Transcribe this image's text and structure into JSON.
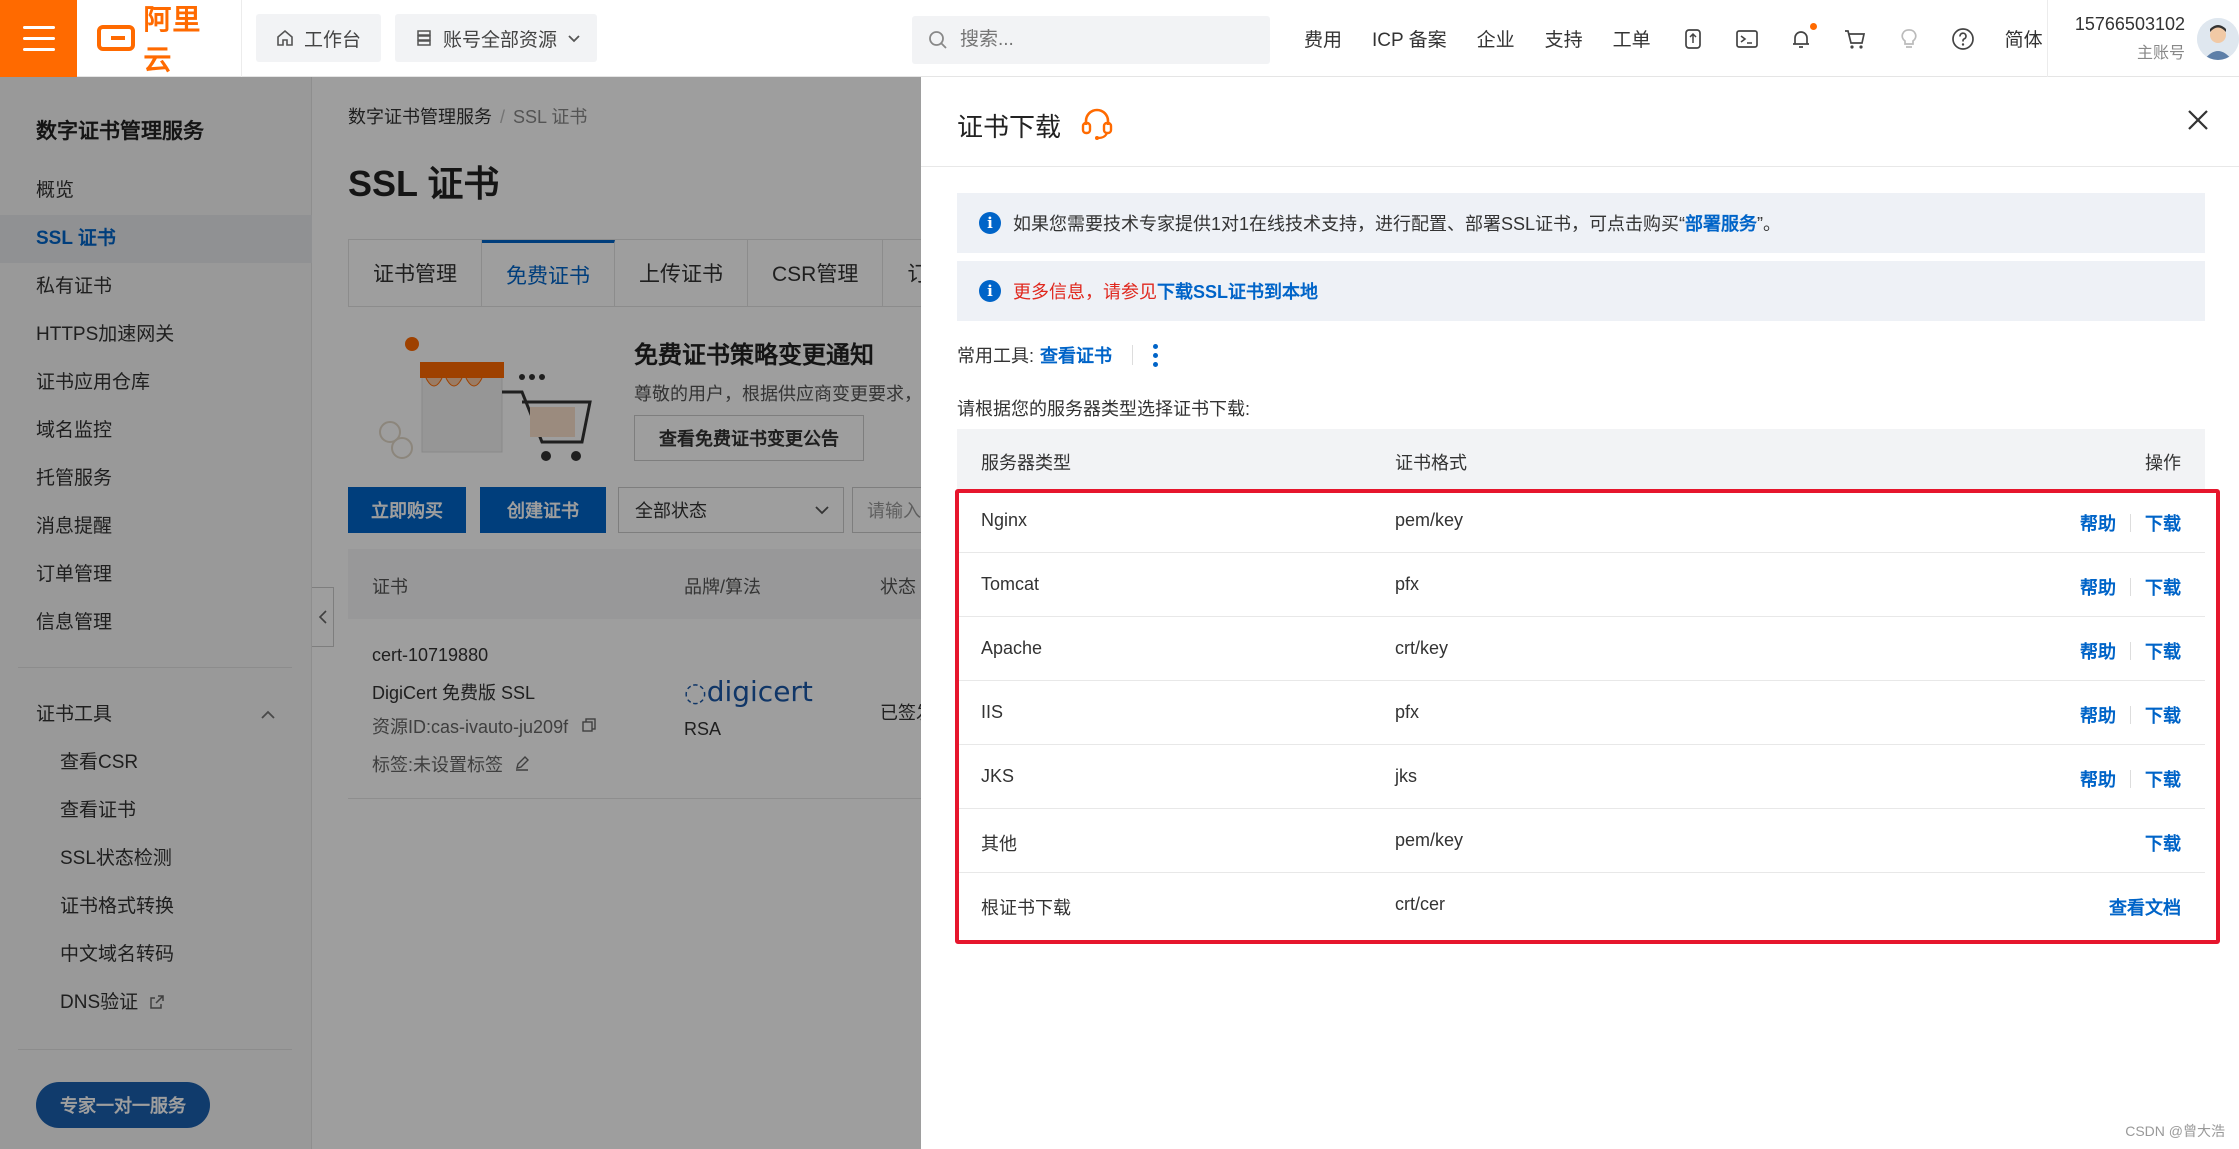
{
  "topbar": {
    "logo_text": "阿里云",
    "workbench": "工作台",
    "resources": "账号全部资源",
    "search_placeholder": "搜索...",
    "links": [
      "费用",
      "ICP 备案",
      "企业",
      "支持",
      "工单"
    ],
    "lang": "简体",
    "account_phone": "15766503102",
    "account_role": "主账号",
    "accent": "#ff6a00"
  },
  "sidebar": {
    "title": "数字证书管理服务",
    "items": [
      "概览",
      "SSL 证书",
      "私有证书",
      "HTTPS加速网关",
      "证书应用仓库",
      "域名监控",
      "托管服务",
      "消息提醒",
      "订单管理",
      "信息管理"
    ],
    "active": "SSL 证书",
    "tools_title": "证书工具",
    "tools": [
      "查看CSR",
      "查看证书",
      "SSL状态检测",
      "证书格式转换",
      "中文域名转码",
      "DNS验证"
    ],
    "expert_button": "专家一对一服务"
  },
  "main": {
    "breadcrumb": [
      "数字证书管理服务",
      "SSL 证书"
    ],
    "title": "SSL 证书",
    "tabs": [
      "证书管理",
      "免费证书",
      "上传证书",
      "CSR管理",
      "订"
    ],
    "active_tab": "免费证书",
    "notice_title": "免费证书策略变更通知",
    "notice_desc": "尊敬的用户，根据供应商变更要求，",
    "notice_button": "查看免费证书变更公告",
    "buy_button": "立即购买",
    "create_button": "创建证书",
    "status_select": "全部状态",
    "filter_placeholder": "请输入",
    "columns": [
      "证书",
      "品牌/算法",
      "状态"
    ],
    "row": {
      "cert_id": "cert-10719880",
      "cert_name": "DigiCert 免费版 SSL",
      "resource_id": "资源ID:cas-ivauto-ju209f",
      "tag": "标签:未设置标签",
      "brand": "digicert",
      "algorithm": "RSA",
      "status": "已签发"
    }
  },
  "drawer": {
    "title": "证书下载",
    "info1_prefix": "如果您需要技术专家提供1对1在线技术支持，进行配置、部署SSL证书，可点击购买“",
    "info1_link": "部署服务",
    "info1_suffix": "”。",
    "info2_prefix": "更多信息，请参见",
    "info2_link": "下载SSL证书到本地",
    "tools_label": "常用工具:",
    "tools_link": "查看证书",
    "choose_tip": "请根据您的服务器类型选择证书下载:",
    "columns": [
      "服务器类型",
      "证书格式",
      "操作"
    ],
    "rows": [
      {
        "server": "Nginx",
        "format": "pem/key",
        "help": "帮助",
        "download": "下载"
      },
      {
        "server": "Tomcat",
        "format": "pfx",
        "help": "帮助",
        "download": "下载"
      },
      {
        "server": "Apache",
        "format": "crt/key",
        "help": "帮助",
        "download": "下载"
      },
      {
        "server": "IIS",
        "format": "pfx",
        "help": "帮助",
        "download": "下载"
      },
      {
        "server": "JKS",
        "format": "jks",
        "help": "帮助",
        "download": "下载"
      },
      {
        "server": "其他",
        "format": "pem/key",
        "help": "",
        "download": "下载"
      },
      {
        "server": "根证书下载",
        "format": "crt/cer",
        "help": "",
        "download": "查看文档"
      }
    ],
    "link_color": "#0064c8",
    "highlight_color": "#e6162d"
  },
  "watermark": "CSDN @曾大浩"
}
